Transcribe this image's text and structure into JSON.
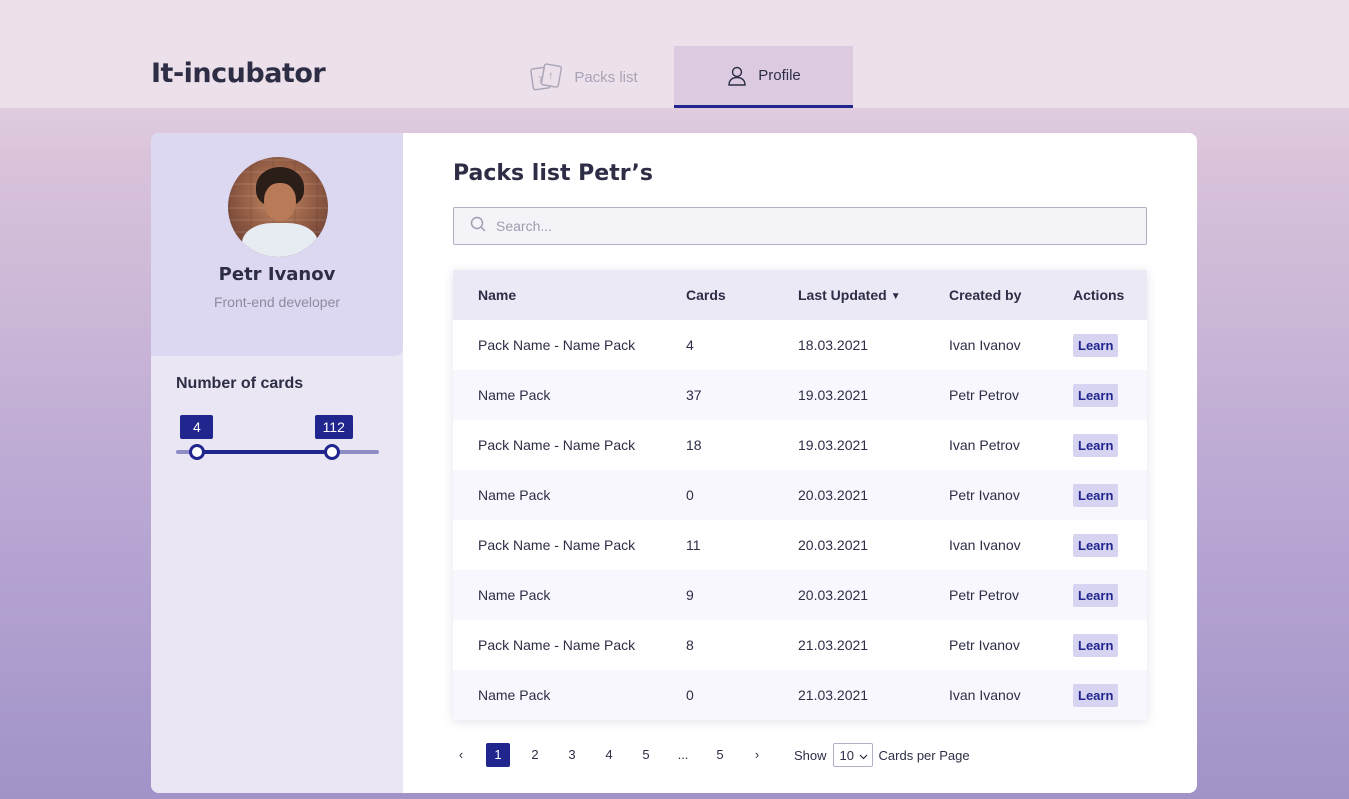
{
  "header": {
    "logo": "It-incubator",
    "tabs": [
      {
        "label": "Packs list",
        "icon": "cards-icon",
        "active": false
      },
      {
        "label": "Profile",
        "icon": "user-icon",
        "active": true
      }
    ],
    "colors": {
      "accent": "#21268f",
      "active_tab_bg": "#dccbe0"
    }
  },
  "profile": {
    "name": "Petr Ivanov",
    "role": "Front-end developer"
  },
  "filter": {
    "title": "Number of cards",
    "min": 4,
    "max": 112,
    "min_label": "4",
    "max_label": "112"
  },
  "main": {
    "title": "Packs list Petr’s",
    "search": {
      "placeholder": "Search...",
      "value": ""
    }
  },
  "table": {
    "columns": [
      "Name",
      "Cards",
      "Last Updated",
      "Created by",
      "Actions"
    ],
    "sort_icon": "▼",
    "rows": [
      {
        "name": "Pack Name - Name Pack",
        "cards": "4",
        "updated": "18.03.2021",
        "by": "Ivan Ivanov",
        "action": "Learn"
      },
      {
        "name": "Name Pack",
        "cards": "37",
        "updated": "19.03.2021",
        "by": "Petr Petrov",
        "action": "Learn"
      },
      {
        "name": "Pack Name - Name Pack",
        "cards": "18",
        "updated": "19.03.2021",
        "by": "Ivan Petrov",
        "action": "Learn"
      },
      {
        "name": "Name Pack",
        "cards": "0",
        "updated": "20.03.2021",
        "by": "Petr Ivanov",
        "action": "Learn"
      },
      {
        "name": "Pack Name - Name Pack",
        "cards": "11",
        "updated": "20.03.2021",
        "by": "Ivan Ivanov",
        "action": "Learn"
      },
      {
        "name": "Name Pack",
        "cards": "9",
        "updated": "20.03.2021",
        "by": "Petr Petrov",
        "action": "Learn"
      },
      {
        "name": "Pack Name - Name Pack",
        "cards": "8",
        "updated": "21.03.2021",
        "by": "Petr Ivanov",
        "action": "Learn"
      },
      {
        "name": "Name Pack",
        "cards": "0",
        "updated": "21.03.2021",
        "by": "Ivan Ivanov",
        "action": "Learn"
      }
    ]
  },
  "pagination": {
    "prev": "‹",
    "next": "›",
    "pages": [
      "1",
      "2",
      "3",
      "4",
      "5",
      "...",
      "5"
    ],
    "active": "1",
    "show_label": "Show",
    "per_page": "10",
    "after_label": "Cards per Page"
  }
}
